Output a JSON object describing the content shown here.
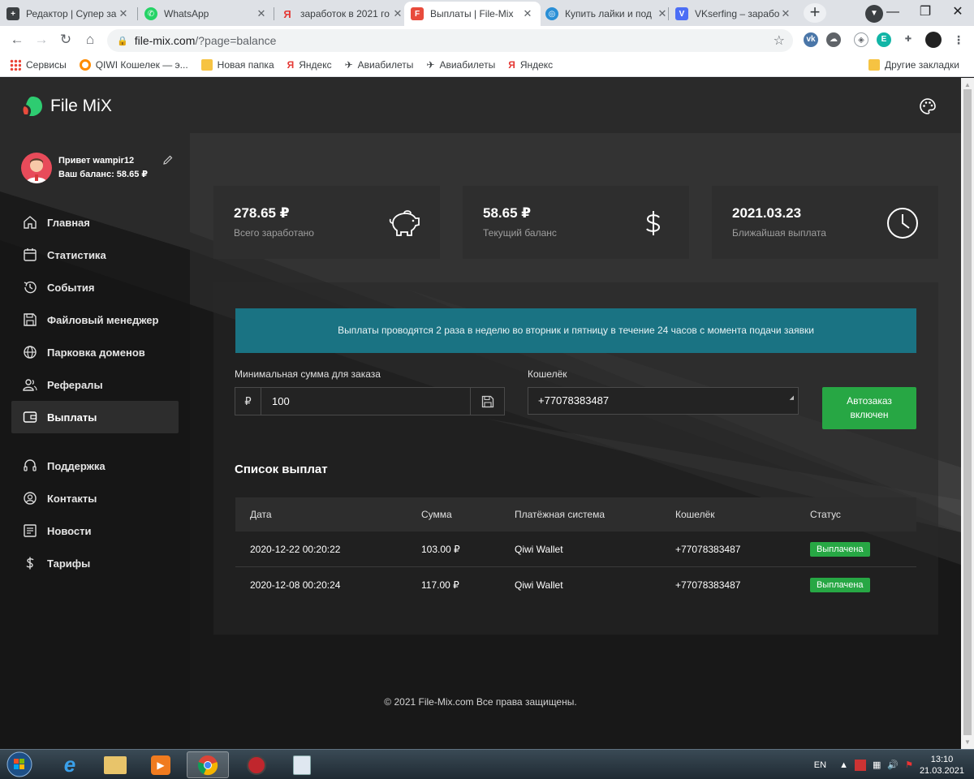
{
  "browser": {
    "tabs": [
      {
        "label": "Редактор | Супер за",
        "favicon_color": "#3c4043",
        "favicon_glyph": "+"
      },
      {
        "label": "WhatsApp",
        "favicon_color": "#25d366",
        "favicon_glyph": "✆"
      },
      {
        "label": "заработок в 2021 го",
        "favicon_color": "#ffffff",
        "favicon_glyph": "Я"
      },
      {
        "label": "Выплаты | File-Mix",
        "favicon_color": "#e84b3c",
        "favicon_glyph": "F"
      },
      {
        "label": "Купить лайки и под",
        "favicon_color": "#2a8fd6",
        "favicon_glyph": "◎"
      },
      {
        "label": "VKserfing – заработ",
        "favicon_color": "#3b5998",
        "favicon_glyph": "V"
      }
    ],
    "active_tab_index": 3,
    "url_host": "file-mix.com",
    "url_path": "/?page=balance",
    "bookmarks": [
      {
        "label": "Сервисы",
        "icon": "apps-grid-icon",
        "color": "#4285f4"
      },
      {
        "label": "QIWI Кошелек — э...",
        "icon": "qiwi-icon",
        "color": "#ff8c00"
      },
      {
        "label": "Новая папка",
        "icon": "folder-icon",
        "color": "#f6c342"
      },
      {
        "label": "Яндекс",
        "icon": "yandex-icon",
        "color": "#e53935"
      },
      {
        "label": "Авиабилеты",
        "icon": "plane-icon",
        "color": "#333333"
      },
      {
        "label": "Авиабилеты",
        "icon": "plane-icon",
        "color": "#333333"
      },
      {
        "label": "Яндекс",
        "icon": "yandex-icon",
        "color": "#e53935"
      }
    ],
    "other_bookmarks": "Другие закладки"
  },
  "site": {
    "logo_text": "File MiX",
    "greeting": "Привет wampir12",
    "balance_line": "Ваш баланс: 58.65 ₽",
    "nav": [
      {
        "label": "Главная",
        "icon": "home-icon"
      },
      {
        "label": "Статистика",
        "icon": "calendar-icon"
      },
      {
        "label": "События",
        "icon": "history-icon"
      },
      {
        "label": "Файловый менеджер",
        "icon": "floppy-icon"
      },
      {
        "label": "Парковка доменов",
        "icon": "globe-icon"
      },
      {
        "label": "Рефералы",
        "icon": "users-icon"
      },
      {
        "label": "Выплаты",
        "icon": "wallet-icon",
        "active": true
      }
    ],
    "nav2": [
      {
        "label": "Поддержка",
        "icon": "headset-icon"
      },
      {
        "label": "Контакты",
        "icon": "contact-icon"
      },
      {
        "label": "Новости",
        "icon": "news-icon"
      },
      {
        "label": "Тарифы",
        "icon": "dollar-icon"
      }
    ],
    "cards": [
      {
        "value": "278.65 ₽",
        "label": "Всего заработано",
        "icon": "piggy-bank-icon"
      },
      {
        "value": "58.65 ₽",
        "label": "Текущий баланс",
        "icon": "dollar-icon"
      },
      {
        "value": "2021.03.23",
        "label": "Ближайшая выплата",
        "icon": "clock-icon"
      }
    ],
    "alert": "Выплаты проводятся 2 раза в неделю во вторник и пятницу в течение 24 часов с момента подачи заявки",
    "min_label": "Минимальная сумма для заказа",
    "currency": "₽",
    "min_value": "100",
    "wallet_label": "Кошелёк",
    "wallet_value": "+77078383487",
    "auto_button_line1": "Автозаказ",
    "auto_button_line2": "включен",
    "list_title": "Список выплат",
    "table_headers": [
      "Дата",
      "Сумма",
      "Платёжная система",
      "Кошелёк",
      "Статус"
    ],
    "rows": [
      {
        "date": "2020-12-22 00:20:22",
        "amount": "103.00 ₽",
        "system": "Qiwi Wallet",
        "wallet": "+77078383487",
        "status": "Выплачена"
      },
      {
        "date": "2020-12-08 00:20:24",
        "amount": "117.00 ₽",
        "system": "Qiwi Wallet",
        "wallet": "+77078383487",
        "status": "Выплачена"
      }
    ],
    "footer": "© 2021 File-Mix.com Все права защищены."
  },
  "taskbar": {
    "lang": "EN",
    "time": "13:10",
    "date": "21.03.2021"
  },
  "colors": {
    "accent_green": "#27a744",
    "alert_teal": "#1a7383",
    "logo_green": "#2ecc71"
  }
}
